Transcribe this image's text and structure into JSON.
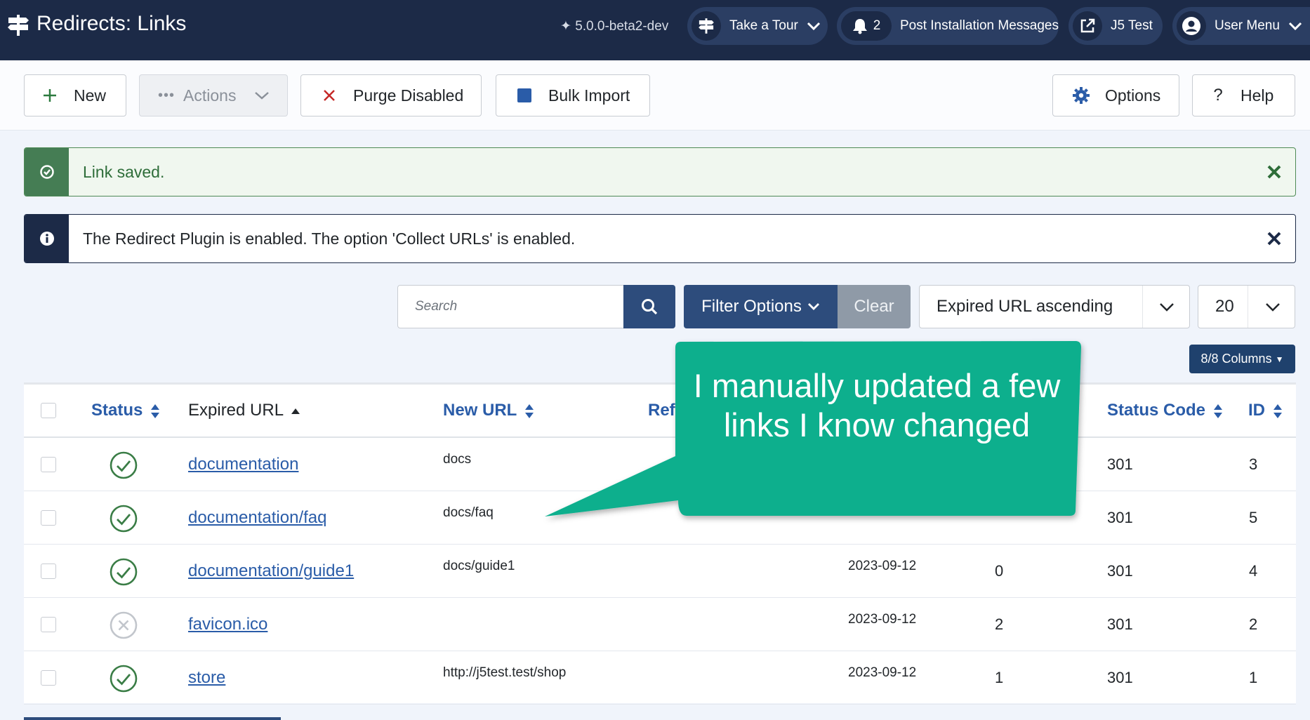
{
  "header": {
    "title": "Redirects: Links",
    "version": "5.0.0-beta2-dev",
    "take_tour": "Take a Tour",
    "notifications_count": "2",
    "post_install": "Post Installation Messages",
    "site_link": "J5 Test",
    "user_menu": "User Menu"
  },
  "toolbar": {
    "new_label": "New",
    "actions_label": "Actions",
    "purge_label": "Purge Disabled",
    "bulk_label": "Bulk Import",
    "options_label": "Options",
    "help_label": "Help"
  },
  "alerts": {
    "success_text": "Link saved.",
    "info_text": "The Redirect Plugin is enabled. The option 'Collect URLs' is enabled."
  },
  "filters": {
    "search_placeholder": "Search",
    "filter_options_label": "Filter Options",
    "clear_label": "Clear",
    "sort_value": "Expired URL ascending",
    "limit_value": "20",
    "columns_label": "8/8 Columns"
  },
  "table": {
    "headers": {
      "status": "Status",
      "expired_url": "Expired URL",
      "new_url": "New URL",
      "referrer": "Refe",
      "status_code": "Status Code",
      "id": "ID"
    },
    "rows": [
      {
        "status": "enabled",
        "expired_url": "documentation",
        "new_url": "docs",
        "date": "",
        "hits": "",
        "code": "301",
        "id": "3"
      },
      {
        "status": "enabled",
        "expired_url": "documentation/faq",
        "new_url": "docs/faq",
        "date": "",
        "hits": "",
        "code": "301",
        "id": "5"
      },
      {
        "status": "enabled",
        "expired_url": "documentation/guide1",
        "new_url": "docs/guide1",
        "date": "2023-09-12",
        "hits": "0",
        "code": "301",
        "id": "4"
      },
      {
        "status": "disabled",
        "expired_url": "favicon.ico",
        "new_url": "",
        "date": "2023-09-12",
        "hits": "2",
        "code": "301",
        "id": "2"
      },
      {
        "status": "enabled",
        "expired_url": "store",
        "new_url": "http://j5test.test/shop",
        "date": "2023-09-12",
        "hits": "1",
        "code": "301",
        "id": "1"
      }
    ]
  },
  "callout": {
    "text": "I manually updated a few links I know changed",
    "color": "#0aaf8d"
  },
  "colors": {
    "header_bg": "#1c2a47",
    "link": "#2a5ca8",
    "success": "#457d54",
    "status_enabled": "#3a7d46",
    "status_disabled": "#c2c6cc"
  }
}
